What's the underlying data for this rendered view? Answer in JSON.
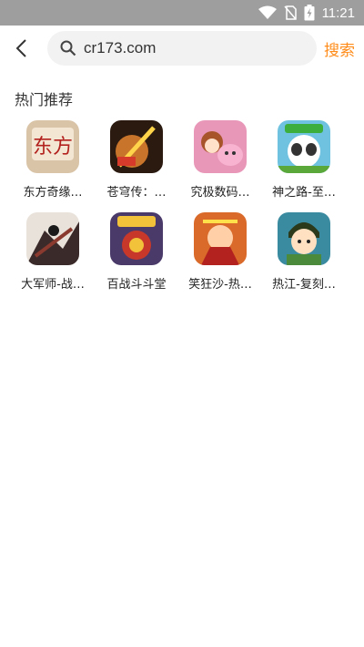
{
  "status": {
    "time": "11:21"
  },
  "search": {
    "value": "cr173.com",
    "button": "搜索"
  },
  "section": {
    "title": "热门推荐"
  },
  "apps": [
    {
      "name": "东方奇缘…",
      "color": "#d9c4a8"
    },
    {
      "name": "苍穹传：…",
      "color": "#c8742a"
    },
    {
      "name": "究极数码…",
      "color": "#e897b8"
    },
    {
      "name": "神之路-至…",
      "color": "#6fc3e0"
    },
    {
      "name": "大军师-战…",
      "color": "#8a3a2e"
    },
    {
      "name": "百战斗斗堂",
      "color": "#4a3a6a"
    },
    {
      "name": "笑狂沙-热…",
      "color": "#d96a2a"
    },
    {
      "name": "热江-复刻…",
      "color": "#3a8aa0"
    }
  ]
}
